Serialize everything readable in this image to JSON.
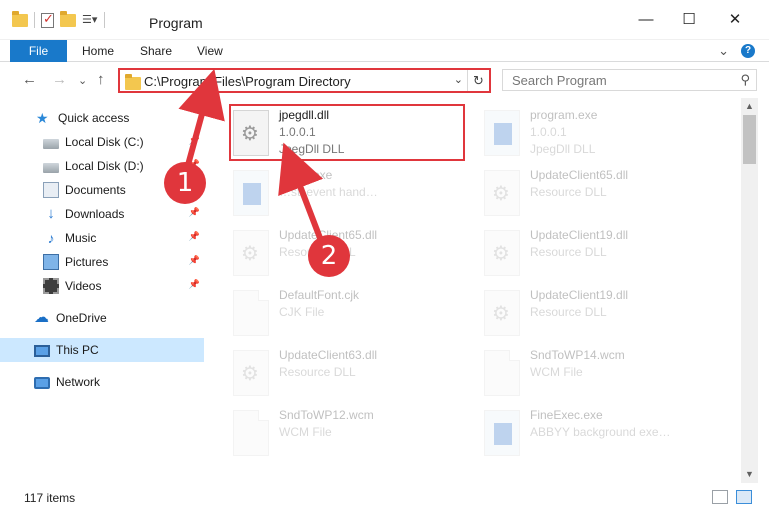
{
  "window": {
    "title": "Program",
    "controls": [
      "—",
      "☐",
      "✕"
    ]
  },
  "ribbon": {
    "file_label": "File",
    "tabs": [
      "Home",
      "Share",
      "View"
    ],
    "expand_glyph": "⌄",
    "help_glyph": "?"
  },
  "nav": {
    "back": "←",
    "forward": "→",
    "recent": "⌄",
    "up": "↑"
  },
  "address": {
    "path": "C:\\Program Files\\Program Directory",
    "dropdown": "⌄",
    "refresh": "↻"
  },
  "search": {
    "placeholder": "Search Program",
    "icon": "⚲"
  },
  "sidebar": {
    "items": [
      {
        "label": "Quick access",
        "icon": "star-icon"
      },
      {
        "label": "Local Disk (C:)",
        "icon": "disk-icon",
        "pinned": true
      },
      {
        "label": "Local Disk (D:)",
        "icon": "disk-icon",
        "pinned": true
      },
      {
        "label": "Documents",
        "icon": "documents-icon",
        "pinned": true
      },
      {
        "label": "Downloads",
        "icon": "downloads-icon",
        "pinned": true
      },
      {
        "label": "Music",
        "icon": "music-icon",
        "pinned": true
      },
      {
        "label": "Pictures",
        "icon": "pictures-icon",
        "pinned": true
      },
      {
        "label": "Videos",
        "icon": "videos-icon",
        "pinned": true
      },
      {
        "label": "OneDrive",
        "icon": "onedrive-icon"
      },
      {
        "label": "This PC",
        "icon": "pc-icon",
        "selected": true
      },
      {
        "label": "Network",
        "icon": "network-icon"
      }
    ],
    "pin_glyph": "📌"
  },
  "files": [
    {
      "name": "jpegdll.dll",
      "line1": "1.0.0.1",
      "line2": "JpegDll DLL",
      "icon": "dll-gear-icon",
      "highlighted": true
    },
    {
      "name": "program.exe",
      "line1": "1.0.0.1",
      "line2": "JpegDll DLL",
      "icon": "exe-icon"
    },
    {
      "name": "…STI.exe",
      "line1": "…sti event hand…",
      "line2": "",
      "icon": "exe-icon"
    },
    {
      "name": "UpdateClient65.dll",
      "line1": "Resource DLL",
      "line2": "",
      "icon": "dll-gear-icon"
    },
    {
      "name": "UpdateClient65.dll",
      "line1": "Resource DLL",
      "line2": "",
      "icon": "dll-gear-icon"
    },
    {
      "name": "UpdateClient19.dll",
      "line1": "Resource DLL",
      "line2": "",
      "icon": "dll-gear-icon"
    },
    {
      "name": "DefaultFont.cjk",
      "line1": "CJK File",
      "line2": "",
      "icon": "blank-file-icon"
    },
    {
      "name": "UpdateClient19.dll",
      "line1": "Resource DLL",
      "line2": "",
      "icon": "dll-gear-icon"
    },
    {
      "name": "UpdateClient63.dll",
      "line1": "Resource DLL",
      "line2": "",
      "icon": "dll-gear-icon"
    },
    {
      "name": "SndToWP14.wcm",
      "line1": "WCM File",
      "line2": "",
      "icon": "blank-file-icon"
    },
    {
      "name": "SndToWP12.wcm",
      "line1": "WCM File",
      "line2": "",
      "icon": "blank-file-icon"
    },
    {
      "name": "FineExec.exe",
      "line1": "ABBYY background exe…",
      "line2": "",
      "icon": "exe-icon"
    }
  ],
  "status": {
    "item_count": "117 items"
  },
  "scroll": {
    "up": "▲",
    "down": "▼"
  },
  "annotations": {
    "step1": "1",
    "step2": "2",
    "color": "#e0363c"
  }
}
